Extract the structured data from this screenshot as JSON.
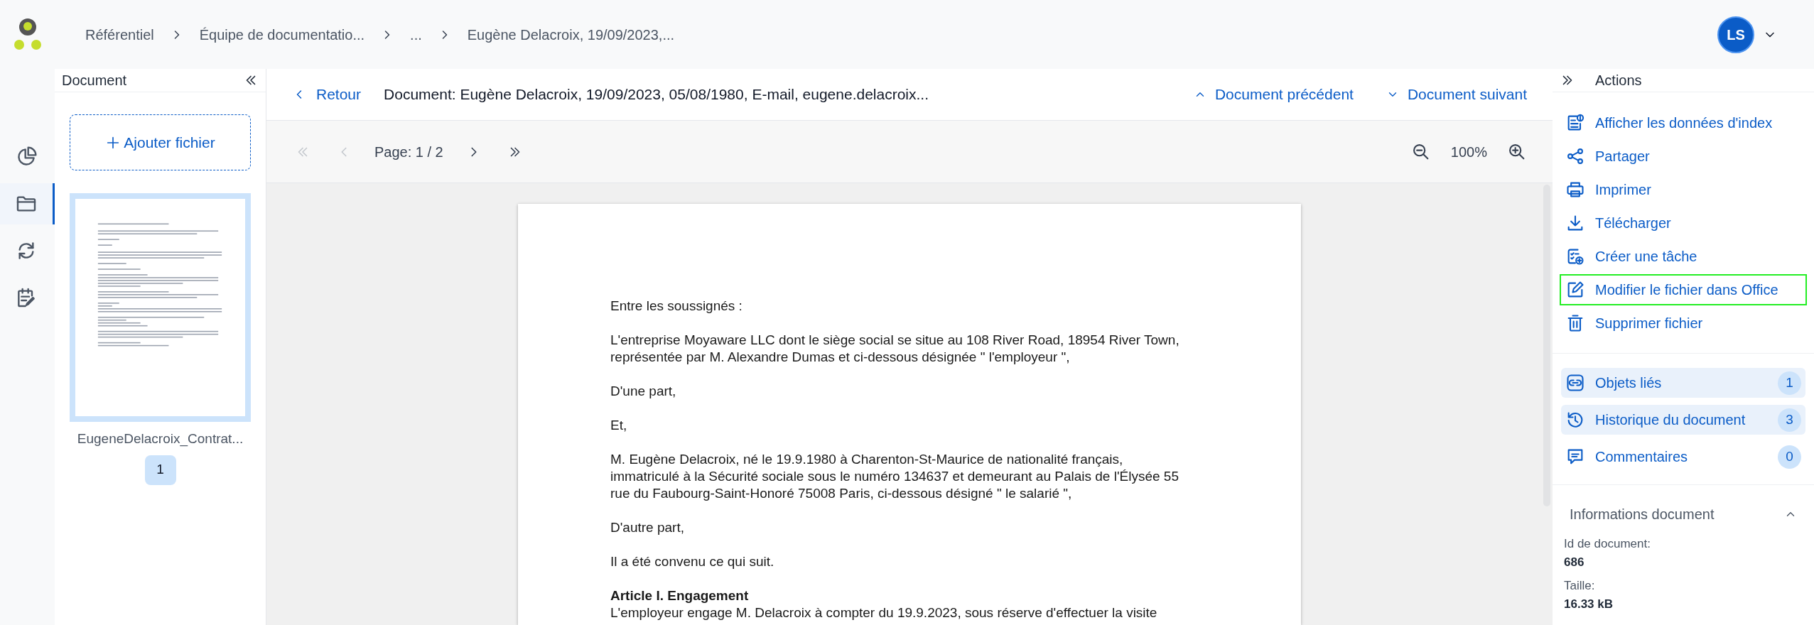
{
  "logo": {
    "kind": "dots"
  },
  "breadcrumb": [
    {
      "label": "Référentiel"
    },
    {
      "label": "Équipe de documentatio..."
    },
    {
      "label": "..."
    },
    {
      "label": "Eugène Delacroix, 19/09/2023,..."
    }
  ],
  "user": {
    "initials": "LS"
  },
  "nav_rail": [
    {
      "kind": "chart",
      "selected": false
    },
    {
      "kind": "folder",
      "selected": true
    },
    {
      "kind": "sync",
      "selected": false
    },
    {
      "kind": "notes",
      "selected": false
    }
  ],
  "document_panel": {
    "title": "Document",
    "add_button": "Ajouter fichier",
    "files": [
      {
        "name": "EugeneDelacroix_Contrat...",
        "page_badge": "1",
        "selected": true
      }
    ]
  },
  "viewer": {
    "back": "Retour",
    "title": "Document: Eugène Delacroix, 19/09/2023, 05/08/1980, E-mail, eugene.delacroix...",
    "previous_document": "Document précédent",
    "next_document": "Document suivant",
    "page_nav": [
      {
        "kind": "first",
        "disabled": true
      },
      {
        "kind": "previous",
        "disabled": true
      },
      {
        "kind": "label",
        "text": "Page: 1 / 2"
      },
      {
        "kind": "next",
        "disabled": false
      },
      {
        "kind": "last",
        "disabled": false
      }
    ],
    "zoom": "100%",
    "paragraphs": [
      {
        "kind": "text",
        "lines": [
          "Entre les soussignés :"
        ]
      },
      {
        "kind": "text",
        "lines": [
          "L'entreprise Moyaware LLC dont le siège social se situe au 108 River Road, 18954 River Town,",
          "représentée par M. Alexandre Dumas et ci-dessous désignée \" l'employeur \","
        ]
      },
      {
        "kind": "text",
        "lines": [
          "D'une part,"
        ]
      },
      {
        "kind": "text",
        "lines": [
          "Et,"
        ]
      },
      {
        "kind": "text",
        "lines": [
          "M. Eugène Delacroix, né le 19.9.1980 à Charenton-St-Maurice de nationalité français,",
          "immatriculé à la Sécurité sociale sous le numéro 134637 et demeurant au Palais de l'Élysée 55",
          "rue du Faubourg-Saint-Honoré 75008 Paris, ci-dessous désigné \" le salarié \","
        ]
      },
      {
        "kind": "text",
        "lines": [
          "D'autre part,"
        ]
      },
      {
        "kind": "text",
        "lines": [
          "Il a été convenu ce qui suit."
        ]
      },
      {
        "kind": "heading",
        "lines": [
          "Article I. Engagement"
        ]
      },
      {
        "kind": "body",
        "lines": [
          "L'employeur engage M. Delacroix à compter du 19.9.2023, sous réserve d'effectuer la visite"
        ]
      }
    ]
  },
  "actions_panel": {
    "title": "Actions",
    "actions": [
      {
        "kind": "index",
        "label": "Afficher les données d'index",
        "highlighted": false
      },
      {
        "kind": "share",
        "label": "Partager",
        "highlighted": false
      },
      {
        "kind": "print",
        "label": "Imprimer",
        "highlighted": false
      },
      {
        "kind": "download",
        "label": "Télécharger",
        "highlighted": false
      },
      {
        "kind": "task",
        "label": "Créer une tâche",
        "highlighted": false
      },
      {
        "kind": "edit",
        "label": "Modifier le fichier dans Office",
        "highlighted": true
      },
      {
        "kind": "delete",
        "label": "Supprimer fichier",
        "highlighted": false
      }
    ],
    "related": [
      {
        "kind": "link",
        "label": "Objets liés",
        "count": "1",
        "shaded": true
      },
      {
        "kind": "history",
        "label": "Historique du document",
        "count": "3",
        "shaded": true
      },
      {
        "kind": "comments",
        "label": "Commentaires",
        "count": "0",
        "shaded": false
      }
    ],
    "info": {
      "title": "Informations document",
      "expanded": true,
      "fields": [
        {
          "label": "Id de document:",
          "value": "686"
        },
        {
          "label": "Taille:",
          "value": "16.33 kB"
        }
      ]
    }
  }
}
